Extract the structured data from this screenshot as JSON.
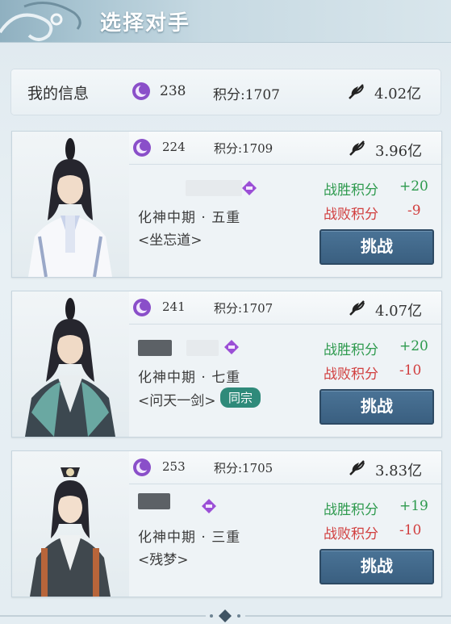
{
  "header": {
    "title": "选择对手"
  },
  "my_info": {
    "label": "我的信息",
    "rank": "238",
    "score": "积分:1707",
    "power": "4.02亿"
  },
  "opponents": [
    {
      "rank": "224",
      "score": "积分:1709",
      "power": "3.96亿",
      "realm": "化神中期 · 五重",
      "sect": "<坐忘道>",
      "same_sect": "",
      "win_label": "战胜积分",
      "win_value": "+20",
      "lose_label": "战败积分",
      "lose_value": "-9",
      "challenge": "挑战"
    },
    {
      "rank": "241",
      "score": "积分:1707",
      "power": "4.07亿",
      "realm": "化神中期 · 七重",
      "sect": "<问天一剑>",
      "same_sect": "同宗",
      "win_label": "战胜积分",
      "win_value": "+20",
      "lose_label": "战败积分",
      "lose_value": "-10",
      "challenge": "挑战"
    },
    {
      "rank": "253",
      "score": "积分:1705",
      "power": "3.83亿",
      "realm": "化神中期 · 三重",
      "sect": "<残梦>",
      "same_sect": "",
      "win_label": "战胜积分",
      "win_value": "+19",
      "lose_label": "战败积分",
      "lose_value": "-10",
      "challenge": "挑战"
    }
  ],
  "icons": {
    "rank": "purple-moon-rank-icon",
    "power": "feather-power-icon",
    "gem": "purple-diamond-gem-icon"
  },
  "colors": {
    "win": "#2e9a4e",
    "lose": "#d13e3e",
    "button": "#3f6687",
    "same_sect": "#2f8a7a"
  }
}
